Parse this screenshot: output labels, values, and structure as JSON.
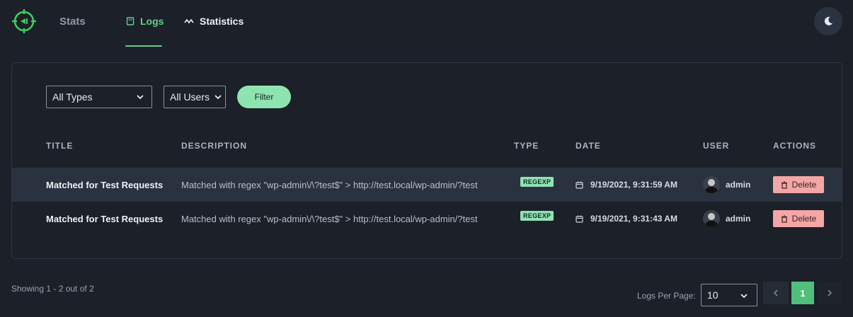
{
  "header": {
    "brand": "Stats",
    "tabs": [
      {
        "label": "Logs",
        "icon": "book-icon",
        "active": true
      },
      {
        "label": "Statistics",
        "icon": "activity-icon",
        "active": false
      }
    ],
    "theme_toggle_icon": "moon-icon",
    "accent_color": "#5fd18b"
  },
  "filters": {
    "type_select": "All Types",
    "user_select": "All Users",
    "filter_button": "Filter"
  },
  "table": {
    "headers": [
      "TITLE",
      "DESCRIPTION",
      "TYPE",
      "DATE",
      "USER",
      "ACTIONS"
    ],
    "rows": [
      {
        "title": "Matched for Test Requests",
        "description": "Matched with regex \"wp-admin\\/\\?test$\" > http://test.local/wp-admin/?test",
        "type": "REGEXP",
        "date": "9/19/2021, 9:31:59 AM",
        "user": "admin",
        "action": "Delete"
      },
      {
        "title": "Matched for Test Requests",
        "description": "Matched with regex \"wp-admin\\/\\?test$\" > http://test.local/wp-admin/?test",
        "type": "REGEXP",
        "date": "9/19/2021, 9:31:43 AM",
        "user": "admin",
        "action": "Delete"
      }
    ]
  },
  "footer": {
    "showing": "Showing 1 - 2 out of 2",
    "per_page_label": "Logs Per Page:",
    "per_page_value": "10",
    "current_page": "1"
  }
}
